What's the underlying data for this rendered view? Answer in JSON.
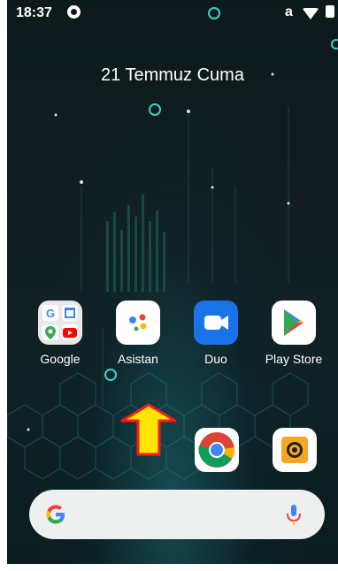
{
  "status_bar": {
    "time": "18:37",
    "carrier_glyph": "a",
    "icons": [
      "app-notification-icon",
      "wifi-icon",
      "battery-icon"
    ]
  },
  "date_widget": {
    "text": "21 Temmuz Cuma"
  },
  "apps": [
    {
      "label": "Google",
      "icon": "google-folder-icon"
    },
    {
      "label": "Asistan",
      "icon": "assistant-icon"
    },
    {
      "label": "Duo",
      "icon": "duo-icon"
    },
    {
      "label": "Play Store",
      "icon": "play-store-icon"
    }
  ],
  "dock": [
    {
      "icon": "chrome-icon"
    },
    {
      "icon": "camera-icon"
    }
  ],
  "search_bar": {
    "icons": [
      "google-g-icon",
      "microphone-icon"
    ]
  },
  "colors": {
    "accent_arrow_fill": "#ffe600",
    "accent_arrow_stroke": "#ff1a1a",
    "duo_blue": "#1a73e8",
    "play_bg": "#ffffff"
  }
}
